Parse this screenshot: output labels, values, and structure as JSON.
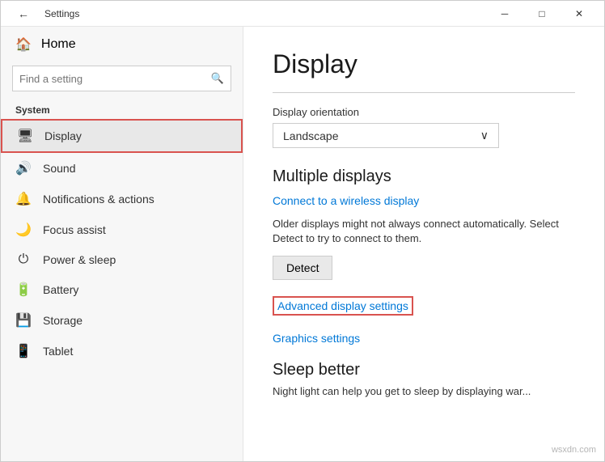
{
  "titlebar": {
    "title": "Settings",
    "back_label": "←",
    "minimize_label": "─",
    "maximize_label": "□",
    "close_label": "✕"
  },
  "sidebar": {
    "home_label": "Home",
    "search_placeholder": "Find a setting",
    "search_icon": "🔍",
    "section_label": "System",
    "items": [
      {
        "id": "display",
        "label": "Display",
        "icon": "🖥",
        "active": true
      },
      {
        "id": "sound",
        "label": "Sound",
        "icon": "🔊",
        "active": false
      },
      {
        "id": "notifications",
        "label": "Notifications & actions",
        "icon": "🔔",
        "active": false
      },
      {
        "id": "focus",
        "label": "Focus assist",
        "icon": "🌙",
        "active": false
      },
      {
        "id": "power",
        "label": "Power & sleep",
        "icon": "⏻",
        "active": false
      },
      {
        "id": "battery",
        "label": "Battery",
        "icon": "🔋",
        "active": false
      },
      {
        "id": "storage",
        "label": "Storage",
        "icon": "💾",
        "active": false
      },
      {
        "id": "tablet",
        "label": "Tablet",
        "icon": "📱",
        "active": false
      }
    ]
  },
  "content": {
    "title": "Display",
    "orientation_label": "Display orientation",
    "orientation_value": "Landscape",
    "multiple_displays_title": "Multiple displays",
    "connect_wireless_label": "Connect to a wireless display",
    "description": "Older displays might not always connect automatically. Select Detect to try to connect to them.",
    "detect_btn": "Detect",
    "advanced_display_label": "Advanced display settings",
    "graphics_settings_label": "Graphics settings",
    "sleep_title": "Sleep better",
    "sleep_desc": "Night light can help you get to sleep by displaying war..."
  },
  "watermark": "wsxdn.com"
}
